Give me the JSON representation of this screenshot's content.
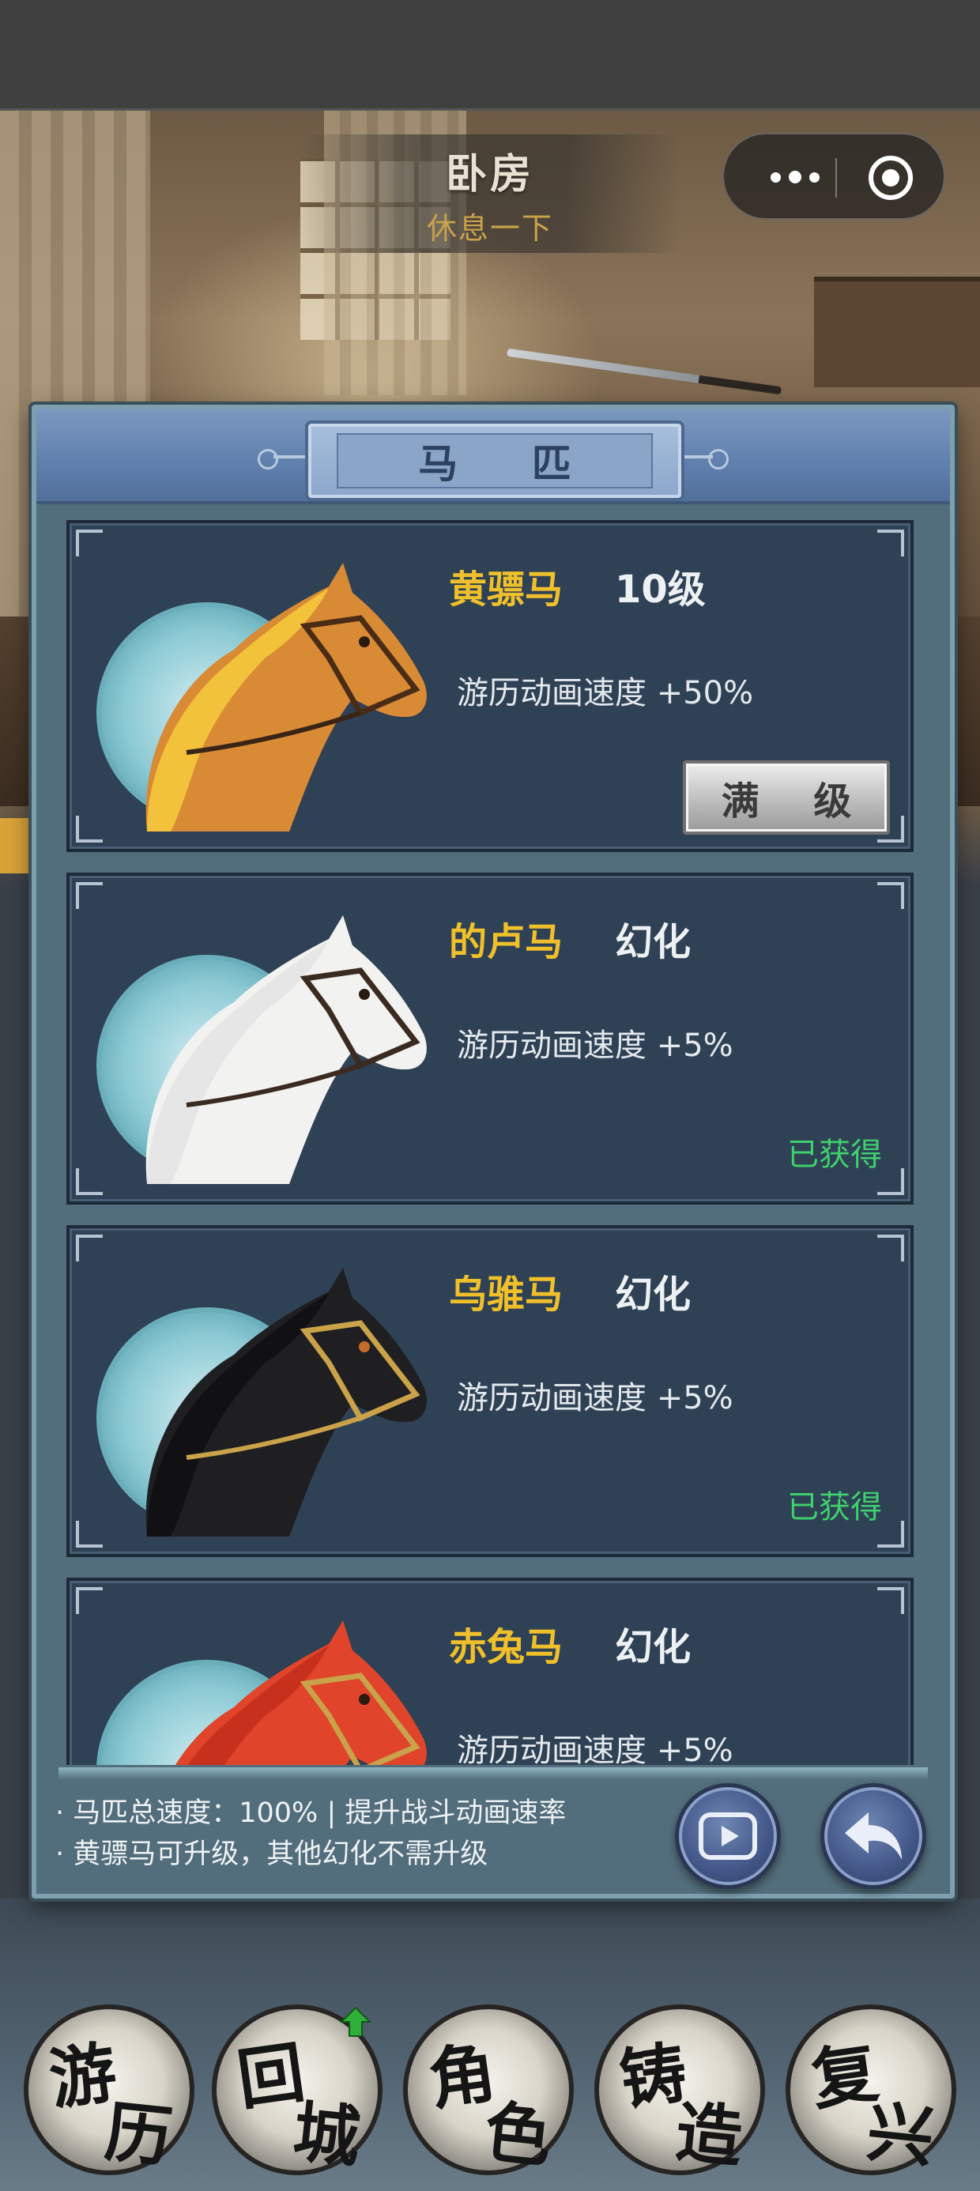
{
  "scene": {
    "room_title": "卧房",
    "room_subtitle": "休息一下"
  },
  "capsule": {
    "more_icon": "more-dots-icon",
    "close_icon": "target-close-icon"
  },
  "panel": {
    "title": "马 匹",
    "horses": [
      {
        "name": "黄骠马",
        "level": "10级",
        "effect": "游历动画速度 +50%",
        "action_label": "满 级",
        "coat_color": "#d98a35",
        "mane_color": "#f2c23a"
      },
      {
        "name": "的卢马",
        "level": "幻化",
        "effect": "游历动画速度 +5%",
        "status": "已获得",
        "coat_color": "#f2f2f0",
        "mane_color": "#e6e6e6"
      },
      {
        "name": "乌骓马",
        "level": "幻化",
        "effect": "游历动画速度 +5%",
        "status": "已获得",
        "coat_color": "#1f1f22",
        "mane_color": "#111114"
      },
      {
        "name": "赤兔马",
        "level": "幻化",
        "effect": "游历动画速度 +5%",
        "coat_color": "#e0442a",
        "mane_color": "#c8301e"
      }
    ],
    "notes": [
      "· 马匹总速度：100% | 提升战斗动画速率",
      "· 黄骠马可升级，其他幻化不需升级"
    ]
  },
  "nav": {
    "items": [
      {
        "char1": "游",
        "char2": "历"
      },
      {
        "char1": "回",
        "char2": "城"
      },
      {
        "char1": "角",
        "char2": "色"
      },
      {
        "char1": "铸",
        "char2": "造"
      },
      {
        "char1": "复",
        "char2": "兴"
      }
    ]
  },
  "colors": {
    "name_gold": "#f0c02a",
    "owned_green": "#3fcf6d",
    "panel_teal": "#526d7b",
    "card_navy": "#2f4155"
  }
}
